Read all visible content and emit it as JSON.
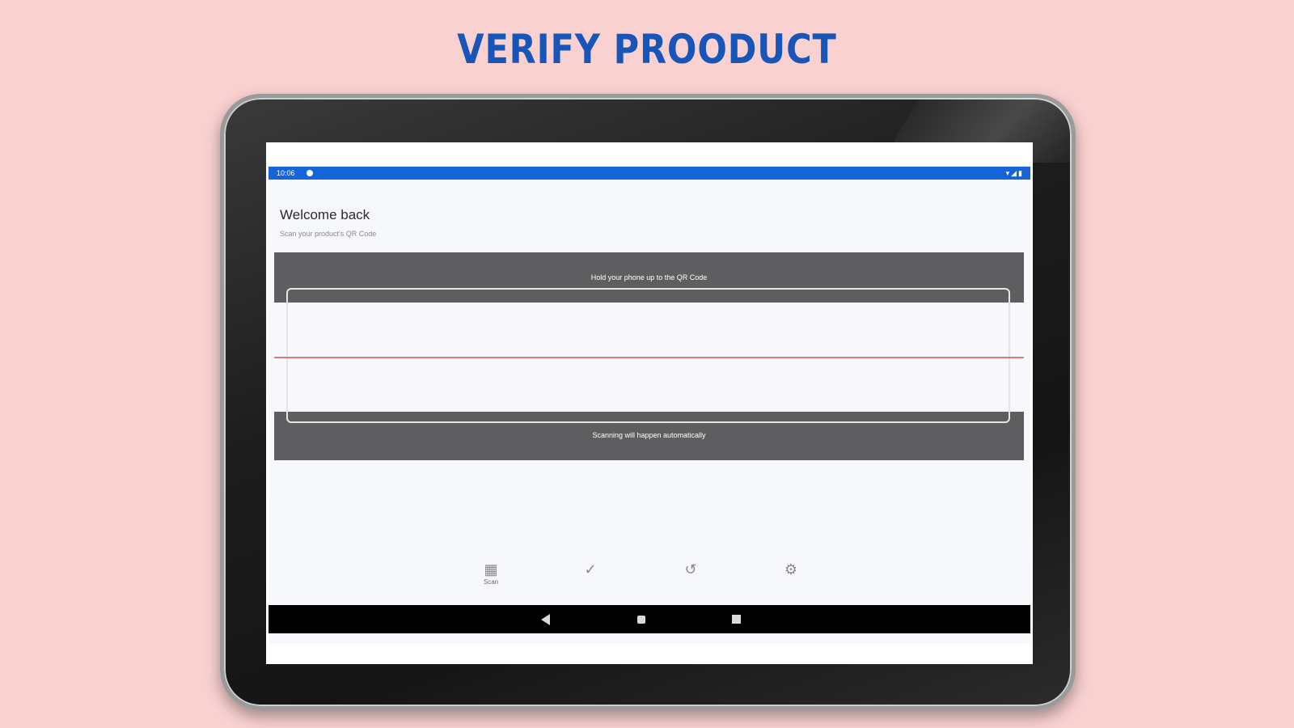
{
  "headline": "VERIFY PROODUCT",
  "colors": {
    "background": "#f9d1d1",
    "headline": "#1756b8",
    "statusbar": "#1565d8",
    "scanner_overlay": "#5e5e60",
    "scan_line": "#e17a7d"
  },
  "status_bar": {
    "time": "10:06",
    "icons": "▾◢▮"
  },
  "app": {
    "welcome": "Welcome back",
    "subtitle": "Scan your product's QR Code"
  },
  "scanner": {
    "hint": "Hold your phone up to the QR Code",
    "auto_text": "Scanning will happen automatically"
  },
  "bottom_nav": {
    "items": [
      {
        "icon": "qr-scan-icon",
        "glyph": "▦",
        "label": "Scan"
      },
      {
        "icon": "check-icon",
        "glyph": "✓",
        "label": ""
      },
      {
        "icon": "history-icon",
        "glyph": "↺",
        "label": ""
      },
      {
        "icon": "settings-icon",
        "glyph": "⚙",
        "label": ""
      }
    ]
  },
  "system_nav": {
    "back": "back-icon",
    "home": "home-icon",
    "recents": "recents-icon"
  }
}
